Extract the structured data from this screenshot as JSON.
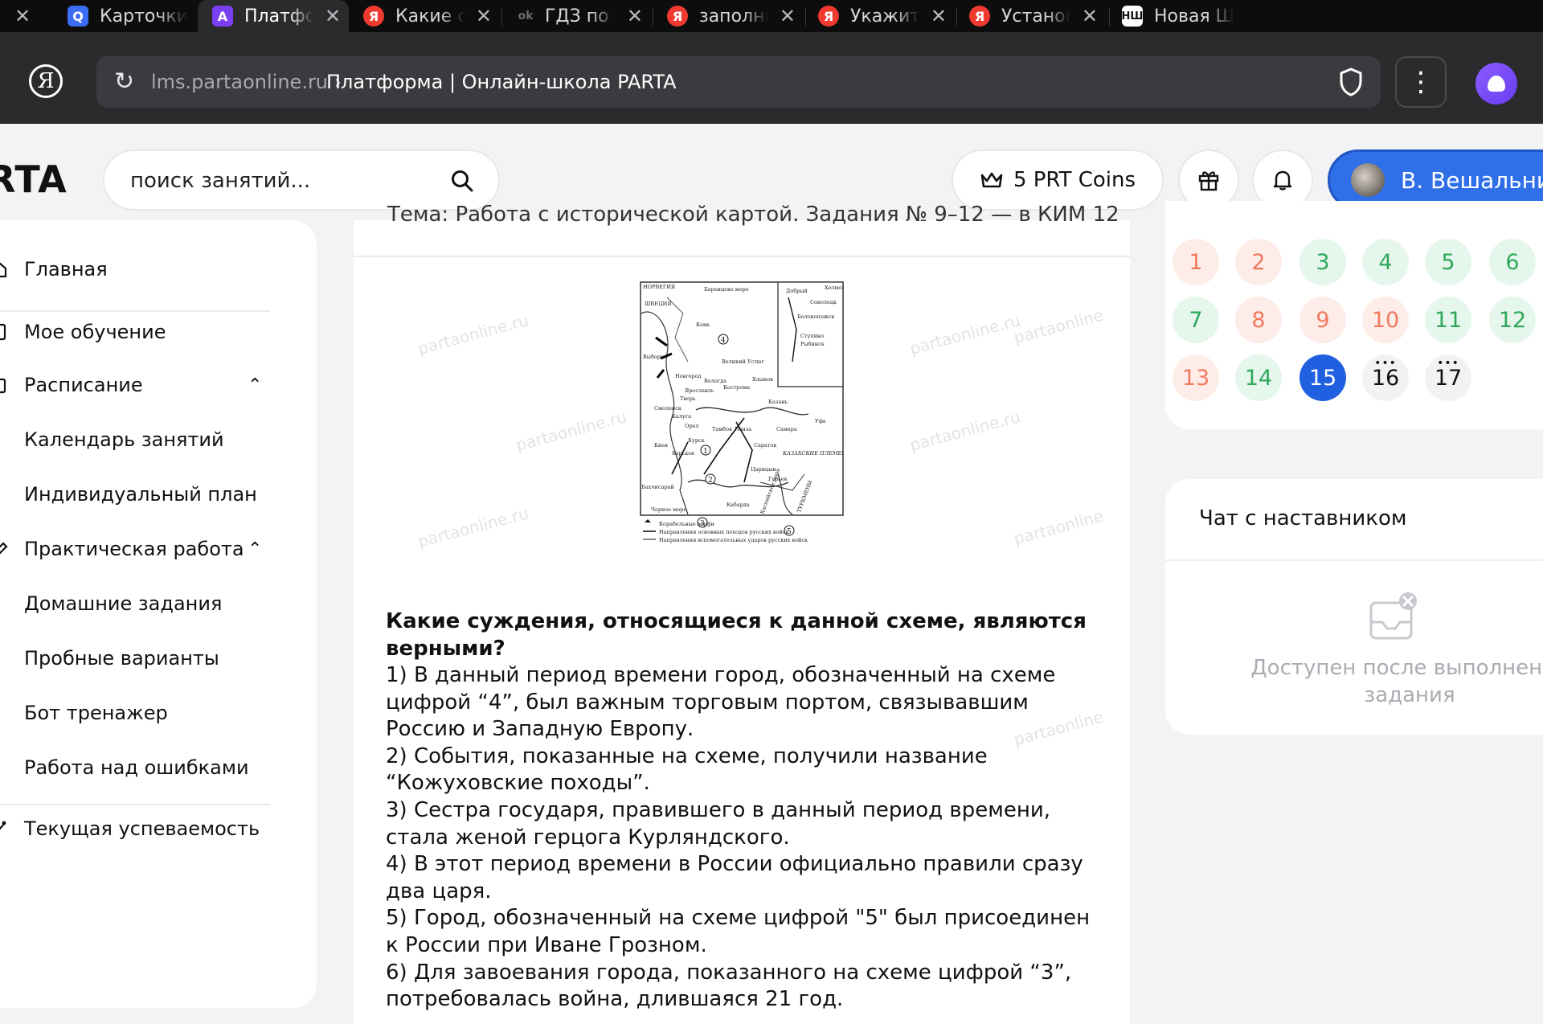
{
  "tabs": [
    {
      "title": "",
      "active": false
    },
    {
      "title": "Карточки",
      "active": false
    },
    {
      "title": "Платформа",
      "active": true
    },
    {
      "title": "Какие суждения",
      "active": false
    },
    {
      "title": "ГДЗ по физике",
      "active": false
    },
    {
      "title": "заполните",
      "active": false
    },
    {
      "title": "Укажите пра",
      "active": false
    },
    {
      "title": "Установите",
      "active": false
    },
    {
      "title": "Новая Школа",
      "active": false
    }
  ],
  "tab_favicons": [
    "Q",
    "A",
    "Я",
    "ok",
    "Я",
    "Я",
    "Я",
    "НШ"
  ],
  "address": {
    "host": "lms.partaonline.ru",
    "separator": " › ",
    "title": "Платформа | Онлайн-школа PARTA"
  },
  "header": {
    "brand": "RTA",
    "search_placeholder": "поиск занятий...",
    "coins": "5 PRT Coins",
    "user": "В. Вешальникова"
  },
  "sidebar": {
    "items": [
      {
        "label": "Главная"
      },
      {
        "label": "Мое обучение"
      },
      {
        "label": "Расписание",
        "chevron": "⌃"
      },
      {
        "label": "Календарь занятий"
      },
      {
        "label": "Индивидуальный план"
      },
      {
        "label": "Практическая работа",
        "chevron": "⌃"
      },
      {
        "label": "Домашние задания"
      },
      {
        "label": "Пробные варианты"
      },
      {
        "label": "Бот тренажер"
      },
      {
        "label": "Работа над ошибками"
      },
      {
        "label": "Текущая успеваемость"
      }
    ]
  },
  "main": {
    "cut_title": "Тема: Работа с исторической картой. Задания № 9–12 — в КИМ 12",
    "watermark": "partaonline.ru",
    "watermark_short": "partaonline",
    "map": {
      "labels": [
        "НОРВЕГИЯ",
        "Баренцево море",
        "ШВЕЦИЯ",
        "Кемь",
        "Добрый",
        "Холмогоры",
        "Соколецк",
        "Белокопожск",
        "Ступино",
        "Рыбинск",
        "Вологда",
        "Выборг",
        "Новгород",
        "Великий Устюг",
        "Кострома",
        "Хлынов",
        "Ярославль",
        "Тверь",
        "Смоленск",
        "Калуга",
        "Казань",
        "Орел",
        "Тамбов",
        "Пенза",
        "Самара",
        "Курск",
        "Саратов",
        "Киев",
        "Харьков",
        "Царицын",
        "КАЗАХСКИЕ ПЛЕМЕНА",
        "Гурьев",
        "Бахчисарай",
        "Черное море",
        "Кабарда",
        "Каспийское море",
        "ТУРКМЕНЫ",
        "Уфа",
        "Корабельные верфи",
        "Направления основных походов русских войск",
        "Направления вспомогательных ударов русских войск"
      ]
    },
    "question": "Какие суждения, относящиеся к данной схеме, являются верными?",
    "answers": [
      "1) В данный период времени город, обозначенный на схеме цифрой “4”, был важным торговым портом, связывавшим Россию и Западную Европу.",
      "2) События, показанные на схеме, получили название “Кожуховские походы”.",
      "3) Сестра государя, правившего в данный период времени, стала женой герцога Курляндского.",
      "4) В этот период времени в России официально правили сразу два царя.",
      "5) Город, обозначенный на схеме цифрой \"5\" был присоединен к России при Иване Грозном.",
      "6) Для завоевания города, показанного на схеме цифрой “3”, потребовалась война, длившаяся 21 год."
    ]
  },
  "days": [
    {
      "n": "1",
      "state": "red"
    },
    {
      "n": "2",
      "state": "red"
    },
    {
      "n": "3",
      "state": "green"
    },
    {
      "n": "4",
      "state": "green"
    },
    {
      "n": "5",
      "state": "green"
    },
    {
      "n": "6",
      "state": "green"
    },
    {
      "n": "7",
      "state": "green"
    },
    {
      "n": "8",
      "state": "red"
    },
    {
      "n": "9",
      "state": "red"
    },
    {
      "n": "10",
      "state": "red"
    },
    {
      "n": "11",
      "state": "green"
    },
    {
      "n": "12",
      "state": "green"
    },
    {
      "n": "13",
      "state": "red"
    },
    {
      "n": "14",
      "state": "green"
    },
    {
      "n": "15",
      "state": "blue"
    },
    {
      "n": "16",
      "state": "gray",
      "dots": true
    },
    {
      "n": "17",
      "state": "gray",
      "dots": true
    }
  ],
  "chat": {
    "title": "Чат с наставником",
    "note": "Доступен после выполнения задания"
  },
  "colors": {
    "accent": "#2f6fe8",
    "active_day": "#1f5fe0",
    "green": "#2fa85c",
    "red": "#f07a5e",
    "favicon_yandex": "#f03a2f",
    "favicon_q": "#3d6cf5",
    "favicon_a": "#7a3ff0"
  }
}
